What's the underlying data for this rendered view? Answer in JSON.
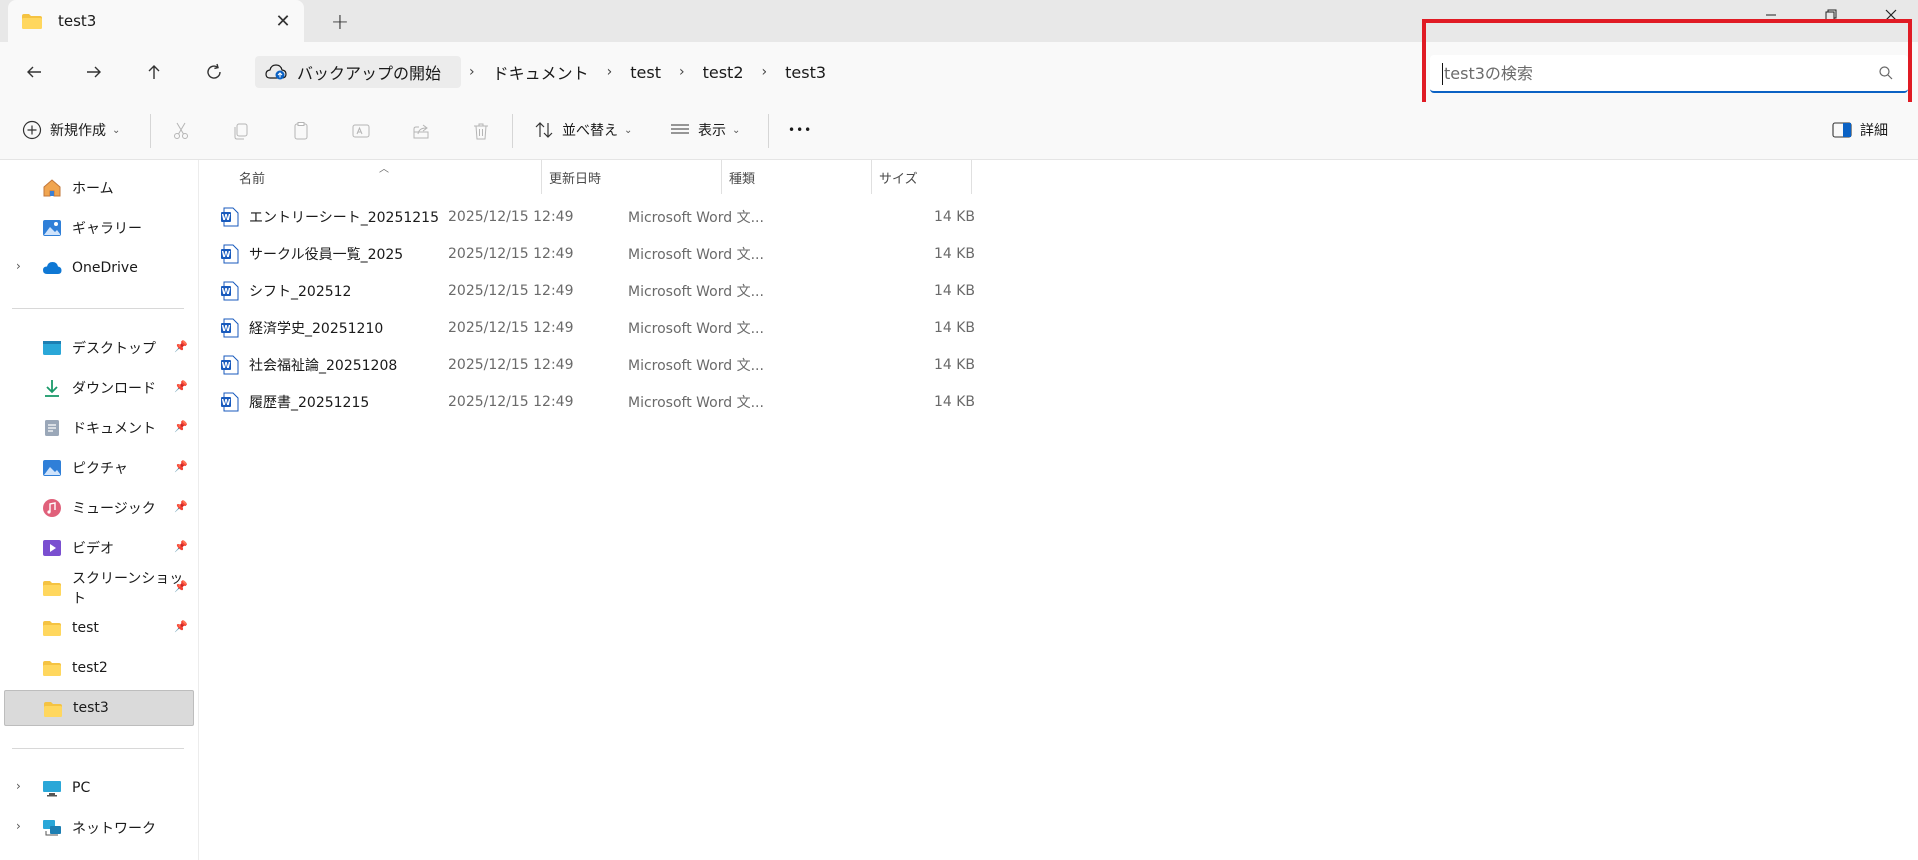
{
  "tab": {
    "title": "test3",
    "close": "✕",
    "new": "+"
  },
  "window": {
    "minimize": "—",
    "maximize": "❐",
    "close": "✕"
  },
  "breadcrumb": {
    "backup": "バックアップの開始",
    "items": [
      "ドキュメント",
      "test",
      "test2",
      "test3"
    ],
    "separator": "›"
  },
  "search": {
    "placeholder": "test3の検索",
    "value": ""
  },
  "toolbar": {
    "new": "新規作成",
    "sort": "並べ替え",
    "view": "表示",
    "more": "•••",
    "details": "詳細"
  },
  "sidebar": {
    "home": "ホーム",
    "gallery": "ギャラリー",
    "onedrive": "OneDrive",
    "desktop": "デスクトップ",
    "downloads": "ダウンロード",
    "documents": "ドキュメント",
    "pictures": "ピクチャ",
    "music": "ミュージック",
    "videos": "ビデオ",
    "screenshots": "スクリーンショット",
    "test": "test",
    "test2": "test2",
    "test3": "test3",
    "pc": "PC",
    "network": "ネットワーク"
  },
  "columns": {
    "name": "名前",
    "date": "更新日時",
    "type": "種類",
    "size": "サイズ"
  },
  "files": [
    {
      "name": "エントリーシート_20251215",
      "date": "2025/12/15 12:49",
      "type": "Microsoft Word 文...",
      "size": "14 KB"
    },
    {
      "name": "サークル役員一覧_2025",
      "date": "2025/12/15 12:49",
      "type": "Microsoft Word 文...",
      "size": "14 KB"
    },
    {
      "name": "シフト_202512",
      "date": "2025/12/15 12:49",
      "type": "Microsoft Word 文...",
      "size": "14 KB"
    },
    {
      "name": "経済学史_20251210",
      "date": "2025/12/15 12:49",
      "type": "Microsoft Word 文...",
      "size": "14 KB"
    },
    {
      "name": "社会福祉論_20251208",
      "date": "2025/12/15 12:49",
      "type": "Microsoft Word 文...",
      "size": "14 KB"
    },
    {
      "name": "履歴書_20251215",
      "date": "2025/12/15 12:49",
      "type": "Microsoft Word 文...",
      "size": "14 KB"
    }
  ],
  "colors": {
    "accent": "#0b62c4",
    "highlight": "#e01b24",
    "folder": "#f5c342",
    "word": "#185abd"
  }
}
